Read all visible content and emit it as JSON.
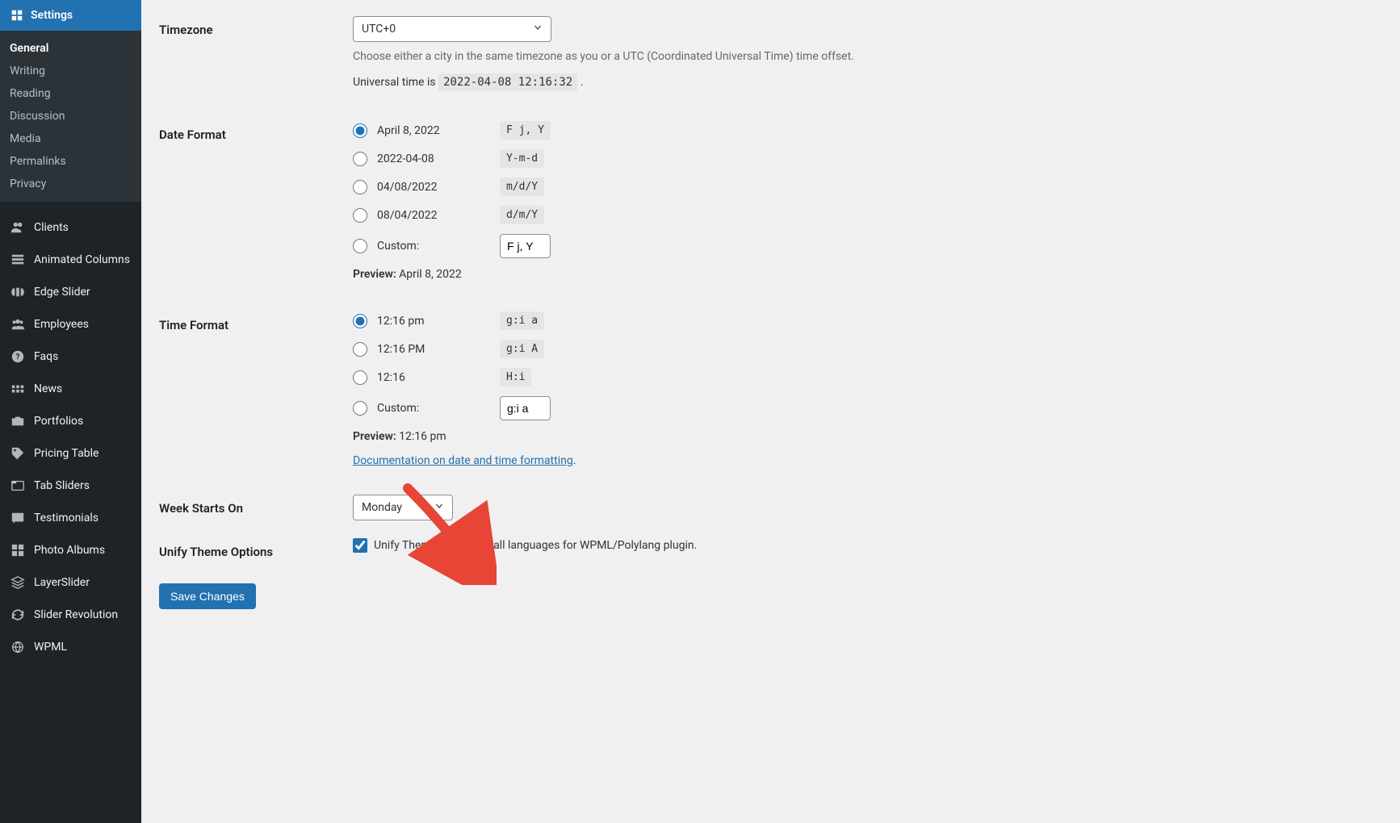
{
  "sidebar": {
    "header": "Settings",
    "sub": [
      "General",
      "Writing",
      "Reading",
      "Discussion",
      "Media",
      "Permalinks",
      "Privacy"
    ],
    "active_sub": 0,
    "items": [
      {
        "icon": "clients-icon",
        "label": "Clients"
      },
      {
        "icon": "columns-icon",
        "label": "Animated Columns"
      },
      {
        "icon": "slider-icon",
        "label": "Edge Slider"
      },
      {
        "icon": "employees-icon",
        "label": "Employees"
      },
      {
        "icon": "faq-icon",
        "label": "Faqs"
      },
      {
        "icon": "news-icon",
        "label": "News"
      },
      {
        "icon": "portfolio-icon",
        "label": "Portfolios"
      },
      {
        "icon": "pricing-icon",
        "label": "Pricing Table"
      },
      {
        "icon": "tabs-icon",
        "label": "Tab Sliders"
      },
      {
        "icon": "testimonials-icon",
        "label": "Testimonials"
      },
      {
        "icon": "albums-icon",
        "label": "Photo Albums"
      },
      {
        "icon": "layers-icon",
        "label": "LayerSlider"
      },
      {
        "icon": "revolve-icon",
        "label": "Slider Revolution"
      },
      {
        "icon": "wpml-icon",
        "label": "WPML"
      }
    ]
  },
  "timezone": {
    "label": "Timezone",
    "value": "UTC+0",
    "desc": "Choose either a city in the same timezone as you or a UTC (Coordinated Universal Time) time offset.",
    "universal_prefix": "Universal time is ",
    "universal_code": "2022-04-08 12:16:32",
    "universal_suffix": "."
  },
  "date_format": {
    "label": "Date Format",
    "options": [
      {
        "display": "April 8, 2022",
        "code": "F j, Y",
        "checked": true
      },
      {
        "display": "2022-04-08",
        "code": "Y-m-d",
        "checked": false
      },
      {
        "display": "04/08/2022",
        "code": "m/d/Y",
        "checked": false
      },
      {
        "display": "08/04/2022",
        "code": "d/m/Y",
        "checked": false
      }
    ],
    "custom_label": "Custom:",
    "custom_value": "F j, Y",
    "preview_label": "Preview:",
    "preview_value": "April 8, 2022"
  },
  "time_format": {
    "label": "Time Format",
    "options": [
      {
        "display": "12:16 pm",
        "code": "g:i a",
        "checked": true
      },
      {
        "display": "12:16 PM",
        "code": "g:i A",
        "checked": false
      },
      {
        "display": "12:16",
        "code": "H:i",
        "checked": false
      }
    ],
    "custom_label": "Custom:",
    "custom_value": "g:i a",
    "preview_label": "Preview:",
    "preview_value": "12:16 pm",
    "doc_link": "Documentation on date and time formatting"
  },
  "week": {
    "label": "Week Starts On",
    "value": "Monday"
  },
  "unify": {
    "label": "Unify Theme Options",
    "text": "Unify Theme Options in all languages for WPML/Polylang plugin.",
    "checked": true
  },
  "save": "Save Changes"
}
